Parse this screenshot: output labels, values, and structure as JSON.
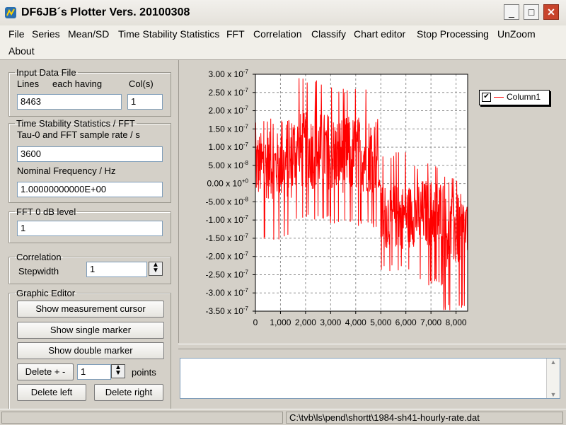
{
  "window": {
    "title": "DF6JB´s Plotter Vers. 20100308"
  },
  "menu": [
    "File",
    "Series",
    "Mean/SD",
    "Time Stability Statistics",
    "FFT",
    "Correlation",
    "Classify",
    "Chart editor",
    "Stop Processing",
    "UnZoom",
    "About"
  ],
  "input_file": {
    "legend": "Input Data File",
    "lines_label": "Lines",
    "each_label": "each having",
    "cols_label": "Col(s)",
    "lines_value": "8463",
    "cols_value": "1"
  },
  "tss": {
    "legend": "Time Stability Statistics / FFT",
    "tau_label": "Tau-0 and FFT sample rate / s",
    "tau_value": "3600",
    "freq_label": "Nominal Frequency / Hz",
    "freq_value": "1.00000000000E+00"
  },
  "fft": {
    "legend": "FFT 0 dB level",
    "value": "1"
  },
  "correlation": {
    "legend": "Correlation",
    "step_label": "Stepwidth",
    "step_value": "1"
  },
  "graphic_editor": {
    "legend": "Graphic Editor",
    "show_cursor": "Show measurement cursor",
    "single_marker": "Show single marker",
    "double_marker": "Show double marker",
    "delete_pm": "Delete + -",
    "delete_pm_value": "1",
    "points_label": "points",
    "delete_left": "Delete left",
    "delete_right": "Delete right"
  },
  "status": {
    "path": "C:\\tvb\\ls\\pend\\shortt\\1984-sh41-hourly-rate.dat"
  },
  "chart_data": {
    "type": "line",
    "title": "",
    "xlabel": "",
    "ylabel": "",
    "xlim": [
      0,
      8463
    ],
    "ylim": [
      -3.5e-07,
      3e-07
    ],
    "x_ticks": [
      "0",
      "1,000",
      "2,000",
      "3,000",
      "4,000",
      "5,000",
      "6,000",
      "7,000",
      "8,000"
    ],
    "x_tick_values": [
      0,
      1000,
      2000,
      3000,
      4000,
      5000,
      6000,
      7000,
      8000
    ],
    "y_ticks": [
      {
        "mant": "3.00",
        "exp": "-7"
      },
      {
        "mant": "2.50",
        "exp": "-7"
      },
      {
        "mant": "2.00",
        "exp": "-7"
      },
      {
        "mant": "1.50",
        "exp": "-7"
      },
      {
        "mant": "1.00",
        "exp": "-7"
      },
      {
        "mant": "5.00",
        "exp": "-8"
      },
      {
        "mant": "0.00",
        "exp": "+0"
      },
      {
        "mant": "-5.00",
        "exp": "-8"
      },
      {
        "mant": "-1.00",
        "exp": "-7"
      },
      {
        "mant": "-1.50",
        "exp": "-7"
      },
      {
        "mant": "-2.00",
        "exp": "-7"
      },
      {
        "mant": "-2.50",
        "exp": "-7"
      },
      {
        "mant": "-3.00",
        "exp": "-7"
      },
      {
        "mant": "-3.50",
        "exp": "-7"
      }
    ],
    "y_tick_values": [
      3e-07,
      2.5e-07,
      2e-07,
      1.5e-07,
      1e-07,
      5e-08,
      0,
      -5e-08,
      -1e-07,
      -1.5e-07,
      -2e-07,
      -2.5e-07,
      -3e-07,
      -3.5e-07
    ],
    "grid": true,
    "legend_position": "top-right",
    "series": [
      {
        "name": "Column1",
        "color": "#ff0000",
        "segments": [
          {
            "x_start": 0,
            "x_end": 1500,
            "mean": 5e-08,
            "spread_low": -1.6e-07,
            "spread_high": 1.8e-07
          },
          {
            "x_start": 1500,
            "x_end": 3000,
            "mean": 9e-08,
            "spread_low": -1e-07,
            "spread_high": 2.9e-07
          },
          {
            "x_start": 3000,
            "x_end": 4900,
            "mean": 8e-08,
            "spread_low": -1.2e-07,
            "spread_high": 2.7e-07
          },
          {
            "x_start": 4900,
            "x_end": 5000,
            "mean": 0.0,
            "spread_low": -2e-08,
            "spread_high": 2e-08
          },
          {
            "x_start": 5000,
            "x_end": 6200,
            "mean": -9e-08,
            "spread_low": -2.4e-07,
            "spread_high": 9e-08
          },
          {
            "x_start": 6200,
            "x_end": 7500,
            "mean": -8e-08,
            "spread_low": -2.8e-07,
            "spread_high": 6e-08
          },
          {
            "x_start": 7500,
            "x_end": 8463,
            "mean": -1.3e-07,
            "spread_low": -3.5e-07,
            "spread_high": 2e-08
          }
        ]
      }
    ]
  }
}
